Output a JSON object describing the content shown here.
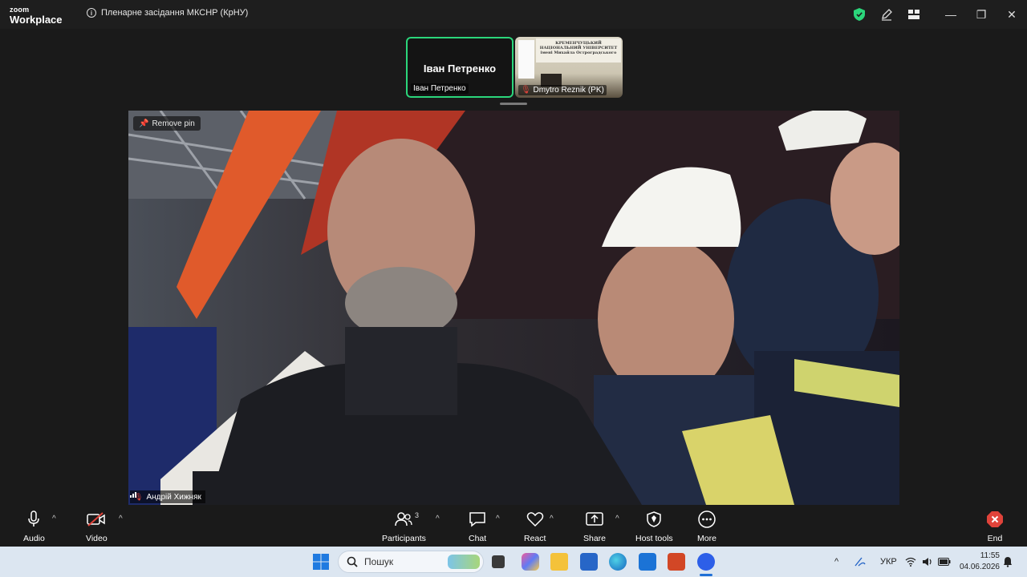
{
  "app": {
    "brand_top": "zoom",
    "brand_bottom": "Workplace",
    "meeting_title": "Пленарне засідання МКСНР (КрНУ)"
  },
  "window_controls": {
    "minimize": "—",
    "restore": "❐",
    "close": "✕"
  },
  "thumbnails": [
    {
      "big_name": "Іван Петренко",
      "label": "Іван Петренко",
      "active": true
    },
    {
      "label": "Dmytro Reznik (PK)",
      "slide_text": "КРЕМЕНЧУЦЬКИЙ НАЦІОНАЛЬНИЙ УНІВЕРСИТЕТ імені Михайла Остроградського",
      "muted": true
    }
  ],
  "video": {
    "remove_pin": "Remove pin",
    "participant_name": "Андрій Хижняк"
  },
  "toolbar": {
    "audio": "Audio",
    "video": "Video",
    "participants": "Participants",
    "participants_count": "3",
    "chat": "Chat",
    "react": "React",
    "share": "Share",
    "host_tools": "Host tools",
    "more": "More",
    "end": "End"
  },
  "taskbar": {
    "search_placeholder": "Пошук",
    "language": "УКР",
    "time": "11:55",
    "date": "04.06.2026"
  }
}
